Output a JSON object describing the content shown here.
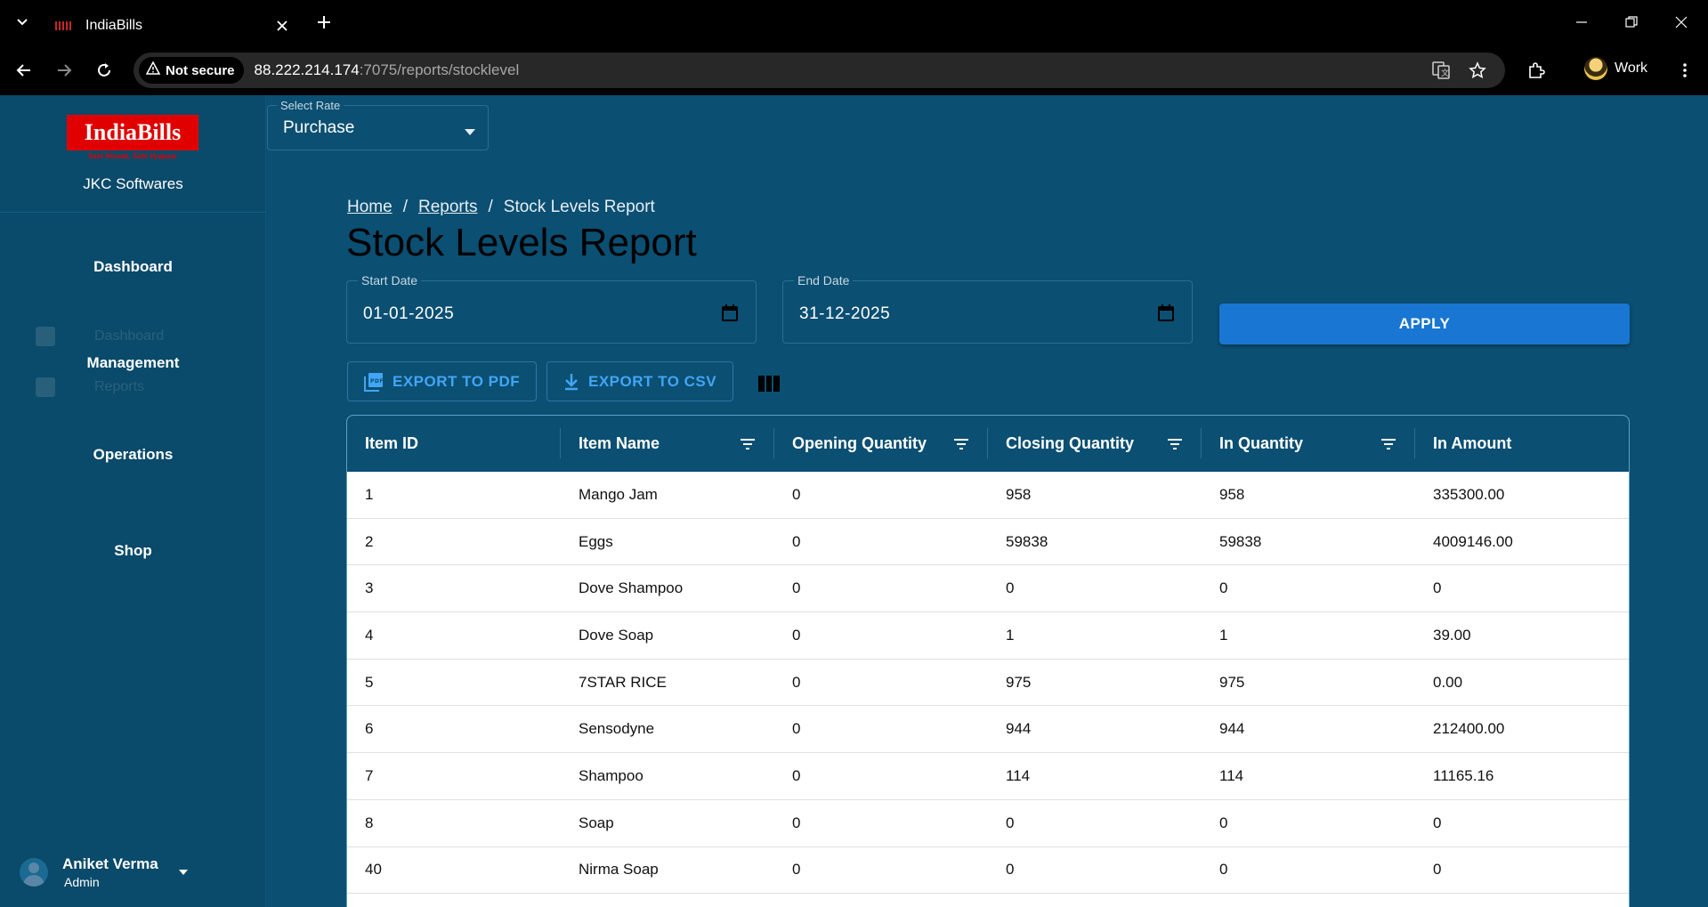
{
  "browser": {
    "tab_title": "IndiaBills",
    "security_label": "Not secure",
    "url_host": "88.222.214.174",
    "url_rest": ":7075/reports/stocklevel",
    "profile_name": "Work"
  },
  "sidebar": {
    "logo_text": "IndiaBills",
    "logo_tagline": "Sabi Hisaab, Sabi Vyapaar",
    "company": "JKC Softwares",
    "sections": [
      "Dashboard",
      "Management",
      "Operations",
      "Shop"
    ],
    "ghost_items": [
      "Dashboard",
      "Reports"
    ],
    "user": {
      "name": "Aniket Verma",
      "role": "Admin"
    }
  },
  "rate_select": {
    "label": "Select Rate",
    "value": "Purchase"
  },
  "breadcrumb": {
    "home": "Home",
    "reports": "Reports",
    "current": "Stock Levels Report",
    "separator": "/"
  },
  "page_title": "Stock Levels Report",
  "filters": {
    "start_label": "Start Date",
    "start_value": "01-01-2025",
    "end_label": "End Date",
    "end_value": "31-12-2025",
    "apply_label": "APPLY"
  },
  "toolbar": {
    "export_pdf": "EXPORT TO PDF",
    "export_csv": "EXPORT TO CSV"
  },
  "table": {
    "columns": [
      "Item ID",
      "Item Name",
      "Opening Quantity",
      "Closing Quantity",
      "In Quantity",
      "In Amount"
    ],
    "rows": [
      [
        "1",
        "Mango Jam",
        "0",
        "958",
        "958",
        "335300.00"
      ],
      [
        "2",
        "Eggs",
        "0",
        "59838",
        "59838",
        "4009146.00"
      ],
      [
        "3",
        "Dove Shampoo",
        "0",
        "0",
        "0",
        "0"
      ],
      [
        "4",
        "Dove Soap",
        "0",
        "1",
        "1",
        "39.00"
      ],
      [
        "5",
        "7STAR RICE",
        "0",
        "975",
        "975",
        "0.00"
      ],
      [
        "6",
        "Sensodyne",
        "0",
        "944",
        "944",
        "212400.00"
      ],
      [
        "7",
        "Shampoo",
        "0",
        "114",
        "114",
        "11165.16"
      ],
      [
        "8",
        "Soap",
        "0",
        "0",
        "0",
        "0"
      ],
      [
        "40",
        "Nirma Soap",
        "0",
        "0",
        "0",
        "0"
      ]
    ]
  }
}
